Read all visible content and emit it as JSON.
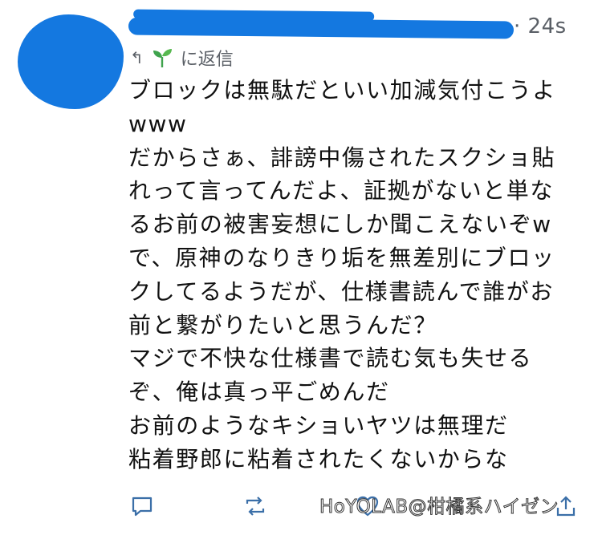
{
  "tweet": {
    "timestamp": "· 24s",
    "reply_label": "に返信",
    "lines": [
      "ブロックは無駄だといい加減気付こうよ",
      "www",
      "だからさぁ、誹謗中傷されたスクショ貼",
      "れって言ってんだよ、証拠がないと単な",
      "るお前の被害妄想にしか聞こえないぞw",
      "で、原神のなりきり垢を無差別にブロッ",
      "クしてるようだが、仕様書読んで誰がお",
      "前と繋がりたいと思うんだ？",
      "マジで不快な仕様書で読む気も失せる",
      "ぞ、俺は真っ平ごめんだ",
      "お前のようなキショいヤツは無理だ",
      "粘着野郎に粘着されたくないからな"
    ]
  },
  "icons": {
    "reply_arrow": "reply-arrow-icon",
    "sprout": "sprout-icon",
    "comment": "comment-icon",
    "retweet": "retweet-icon",
    "like": "heart-icon"
  },
  "watermark": "HoYOLAB@柑橘系ハイゼン",
  "colors": {
    "redaction": "#1478e0",
    "muted": "#5a5f66",
    "action": "#3b6fa8",
    "sprout": "#3fa34d"
  }
}
